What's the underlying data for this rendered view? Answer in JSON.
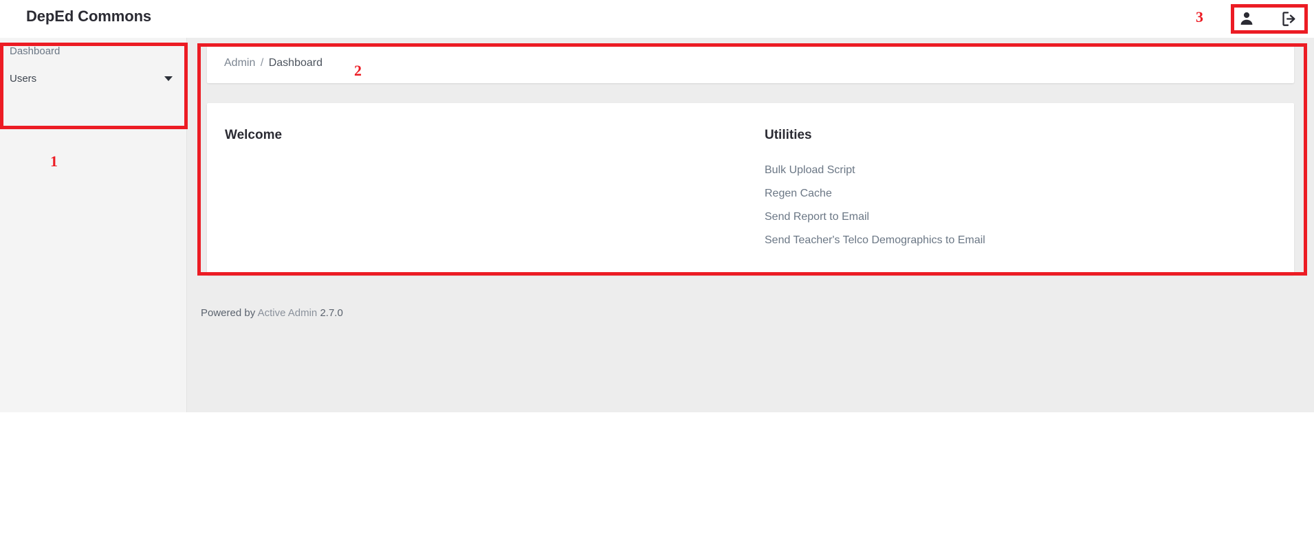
{
  "header": {
    "site_title": "DepEd Commons",
    "actions": [
      {
        "name": "account-icon",
        "label": "Account"
      },
      {
        "name": "logout-icon",
        "label": "Logout"
      }
    ]
  },
  "sidebar": {
    "items": [
      {
        "label": "Dashboard",
        "has_caret": false
      },
      {
        "label": "Users",
        "has_caret": true
      }
    ]
  },
  "breadcrumb": {
    "parent": "Admin",
    "separator": "/",
    "current": "Dashboard"
  },
  "main": {
    "welcome": {
      "heading": "Welcome",
      "body": ""
    },
    "utilities": {
      "heading": "Utilities",
      "links": [
        "Bulk Upload Script",
        "Regen Cache",
        "Send Report to Email",
        "Send Teacher's Telco Demographics to Email"
      ]
    }
  },
  "footer": {
    "prefix": "Powered by",
    "link": "Active Admin",
    "version": "2.7.0"
  },
  "annotations": {
    "labels": [
      "1",
      "2",
      "3"
    ],
    "color": "#ec1c24"
  },
  "colors": {
    "page_background": "#ededed",
    "sidebar_background": "#f4f4f4",
    "panel_background": "#ffffff",
    "header_background": "#ffffff",
    "title_text": "#2b2b33",
    "muted_text": "#6b7785",
    "annotation_red": "#ec1c24"
  }
}
